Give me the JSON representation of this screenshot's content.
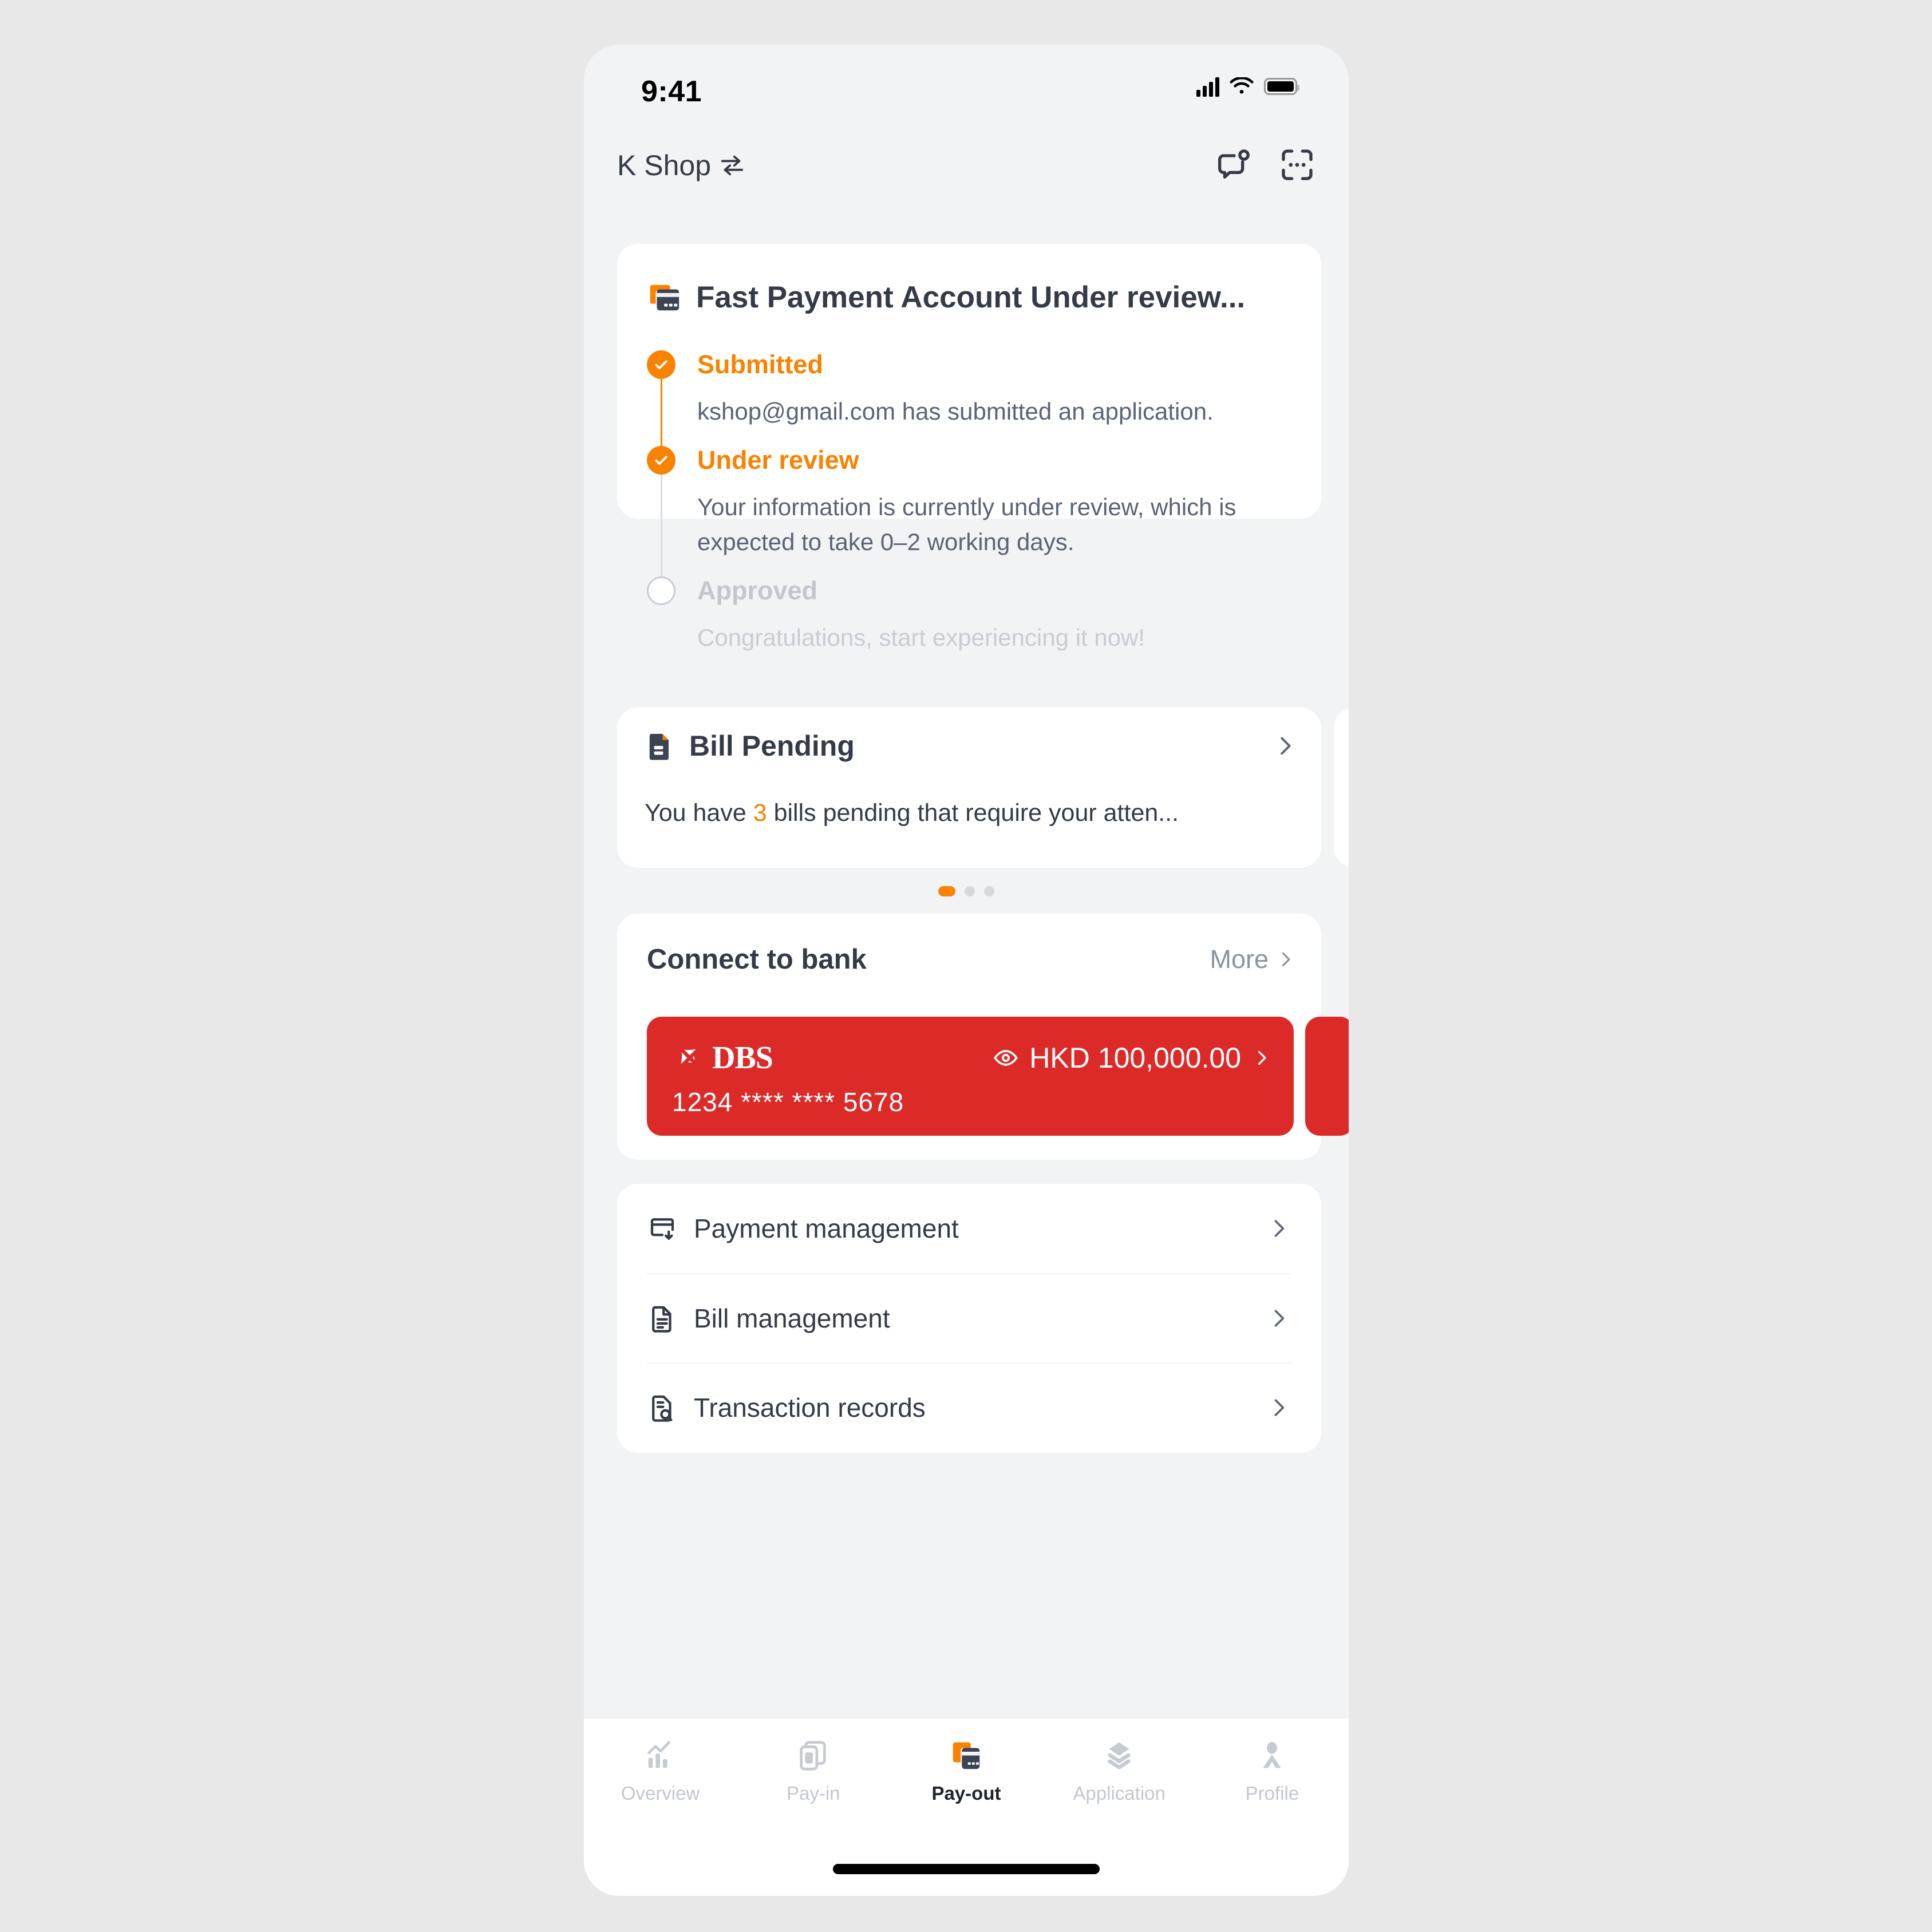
{
  "theme": {
    "accent": "#F98200",
    "bank_red": "#DC2A28",
    "text_dark": "#343B47",
    "text_muted": "#8C939F",
    "page_bg": "#E8E8E8",
    "screen_bg": "#F2F3F5"
  },
  "status_bar": {
    "time": "9:41",
    "signal_icon": "cellular-signal-icon",
    "wifi_icon": "wifi-icon",
    "battery_icon": "battery-icon"
  },
  "app_bar": {
    "shop_name": "K Shop",
    "switch_icon": "switch-arrows-icon",
    "message_icon": "message-notification-icon",
    "scan_icon": "scan-qr-icon"
  },
  "status_card": {
    "icon": "payment-cards-icon",
    "title": "Fast Payment Account Under review...",
    "steps": [
      {
        "label": "Submitted",
        "description": "kshop@gmail.com has submitted an application.",
        "state": "done"
      },
      {
        "label": "Under review",
        "description": "Your information is currently under review, which is expected to take 0–2 working days.",
        "state": "done"
      },
      {
        "label": "Approved",
        "description": "Congratulations, start experiencing it now!",
        "state": "todo"
      }
    ]
  },
  "bill_card": {
    "icon": "document-alert-icon",
    "title": "Bill Pending",
    "chevron_icon": "chevron-right-icon",
    "desc_prefix": "You have ",
    "count": "3",
    "desc_suffix": " bills pending that require your atten..."
  },
  "carousel": {
    "total_dots": 3,
    "active_index": 0
  },
  "bank_section": {
    "title": "Connect to bank",
    "more_label": "More",
    "more_chevron_icon": "chevron-right-icon",
    "card": {
      "bank_name": "DBS",
      "logo_icon": "dbs-logo-icon",
      "eye_icon": "eye-visible-icon",
      "balance": "HKD 100,000.00",
      "chevron_icon": "chevron-right-icon",
      "card_number": "1234 **** **** 5678"
    }
  },
  "menu": {
    "items": [
      {
        "label": "Payment management",
        "icon": "card-download-icon",
        "chevron_icon": "chevron-right-icon"
      },
      {
        "label": "Bill management",
        "icon": "document-lines-icon",
        "chevron_icon": "chevron-right-icon"
      },
      {
        "label": "Transaction records",
        "icon": "document-search-icon",
        "chevron_icon": "chevron-right-icon"
      }
    ]
  },
  "tab_bar": {
    "active_index": 2,
    "items": [
      {
        "label": "Overview",
        "icon": "chart-bars-icon"
      },
      {
        "label": "Pay-in",
        "icon": "pay-in-card-icon"
      },
      {
        "label": "Pay-out",
        "icon": "pay-out-card-icon"
      },
      {
        "label": "Application",
        "icon": "layers-icon"
      },
      {
        "label": "Profile",
        "icon": "person-icon"
      }
    ]
  }
}
